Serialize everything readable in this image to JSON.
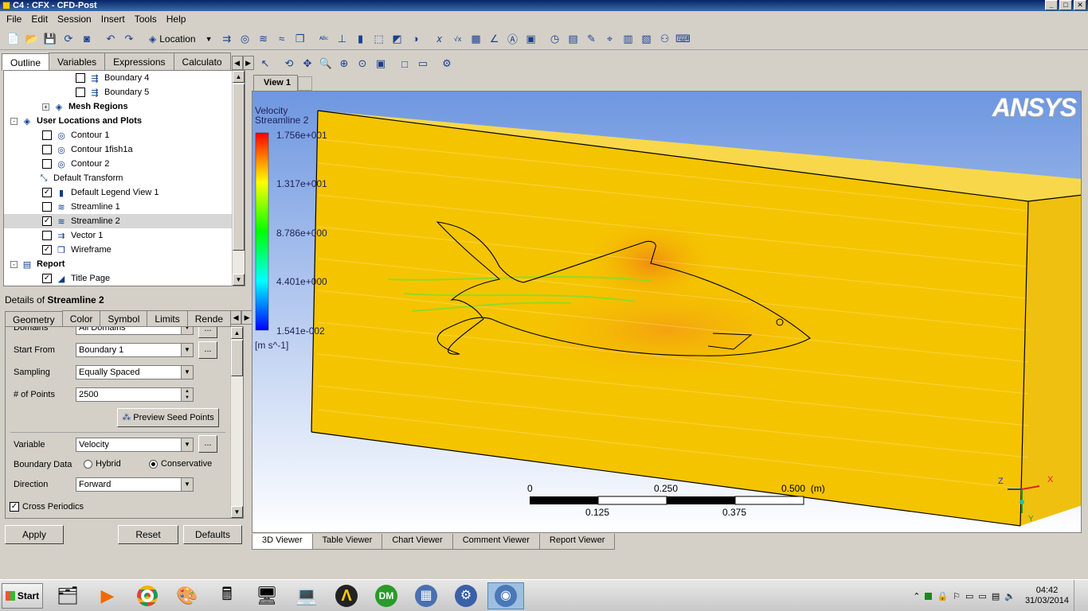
{
  "window": {
    "title": "C4 : CFX - CFD-Post"
  },
  "menu": [
    "File",
    "Edit",
    "Session",
    "Insert",
    "Tools",
    "Help"
  ],
  "toolbar": {
    "location_label": "Location"
  },
  "left_tabs": [
    "Outline",
    "Variables",
    "Expressions",
    "Calculato"
  ],
  "tree": [
    {
      "label": "Boundary 4",
      "checked": false,
      "indent": 90,
      "bold": false,
      "icon": "boundary-icon"
    },
    {
      "label": "Boundary 5",
      "checked": false,
      "indent": 90,
      "bold": false,
      "icon": "boundary-icon"
    },
    {
      "label": "Mesh Regions",
      "checked": null,
      "indent": 48,
      "bold": true,
      "icon": "mesh-icon",
      "expander": "+"
    },
    {
      "label": "User Locations and Plots",
      "checked": null,
      "indent": 8,
      "bold": true,
      "icon": "folder-icon",
      "expander": "-"
    },
    {
      "label": "Contour 1",
      "checked": false,
      "indent": 48,
      "bold": false,
      "icon": "contour-icon"
    },
    {
      "label": "Contour 1fish1a",
      "checked": false,
      "indent": 48,
      "bold": false,
      "icon": "contour-icon"
    },
    {
      "label": "Contour 2",
      "checked": false,
      "indent": 48,
      "bold": false,
      "icon": "contour-icon"
    },
    {
      "label": "Default Transform",
      "checked": null,
      "indent": 42,
      "bold": false,
      "icon": "transform-icon"
    },
    {
      "label": "Default Legend View 1",
      "checked": true,
      "indent": 48,
      "bold": false,
      "icon": "legend-icon"
    },
    {
      "label": "Streamline 1",
      "checked": false,
      "indent": 48,
      "bold": false,
      "icon": "streamline-icon"
    },
    {
      "label": "Streamline 2",
      "checked": true,
      "indent": 48,
      "bold": false,
      "icon": "streamline-icon",
      "selected": true
    },
    {
      "label": "Vector 1",
      "checked": false,
      "indent": 48,
      "bold": false,
      "icon": "vector-icon"
    },
    {
      "label": "Wireframe",
      "checked": true,
      "indent": 48,
      "bold": false,
      "icon": "wireframe-icon"
    },
    {
      "label": "Report",
      "checked": null,
      "indent": 8,
      "bold": true,
      "icon": "report-icon",
      "expander": "-"
    },
    {
      "label": "Title Page",
      "checked": true,
      "indent": 48,
      "bold": false,
      "icon": "page-icon"
    }
  ],
  "details": {
    "prefix": "Details of ",
    "object": "Streamline 2",
    "tabs": [
      "Geometry",
      "Color",
      "Symbol",
      "Limits",
      "Rende"
    ],
    "domains_label": "Domains",
    "domains_value": "All Domains",
    "start_from_label": "Start From",
    "start_from_value": "Boundary 1",
    "sampling_label": "Sampling",
    "sampling_value": "Equally Spaced",
    "points_label": "# of Points",
    "points_value": "2500",
    "preview_label": "Preview Seed Points",
    "variable_label": "Variable",
    "variable_value": "Velocity",
    "boundary_data_label": "Boundary Data",
    "hybrid_label": "Hybrid",
    "conservative_label": "Conservative",
    "direction_label": "Direction",
    "direction_value": "Forward",
    "cross_periodics_label": "Cross Periodics",
    "dots": "..."
  },
  "buttons": {
    "apply": "Apply",
    "reset": "Reset",
    "defaults": "Defaults"
  },
  "viewer": {
    "tab": "View 1",
    "legend_title1": "Velocity",
    "legend_title2": "Streamline 2",
    "legend_values": [
      "1.756e+001",
      "1.317e+001",
      "8.786e+000",
      "4.401e+000",
      "1.541e-002"
    ],
    "legend_unit": "[m s^-1]",
    "logo": "ANSYS",
    "scale_top": [
      "0",
      "0.250",
      "0.500  (m)"
    ],
    "scale_bottom": [
      "0.125",
      "0.375"
    ],
    "axis_x": "X",
    "axis_z": "Z",
    "axis_y": "Y"
  },
  "bottom_tabs": [
    "3D Viewer",
    "Table Viewer",
    "Chart Viewer",
    "Comment Viewer",
    "Report Viewer"
  ],
  "taskbar": {
    "start": "Start",
    "time": "04:42",
    "date": "31/03/2014"
  },
  "colors": {
    "title_bar": "#0a246a",
    "flow_yellow": "#f5c400",
    "flow_orange": "#f39a14",
    "sky_blue": "#7aa6e6"
  }
}
